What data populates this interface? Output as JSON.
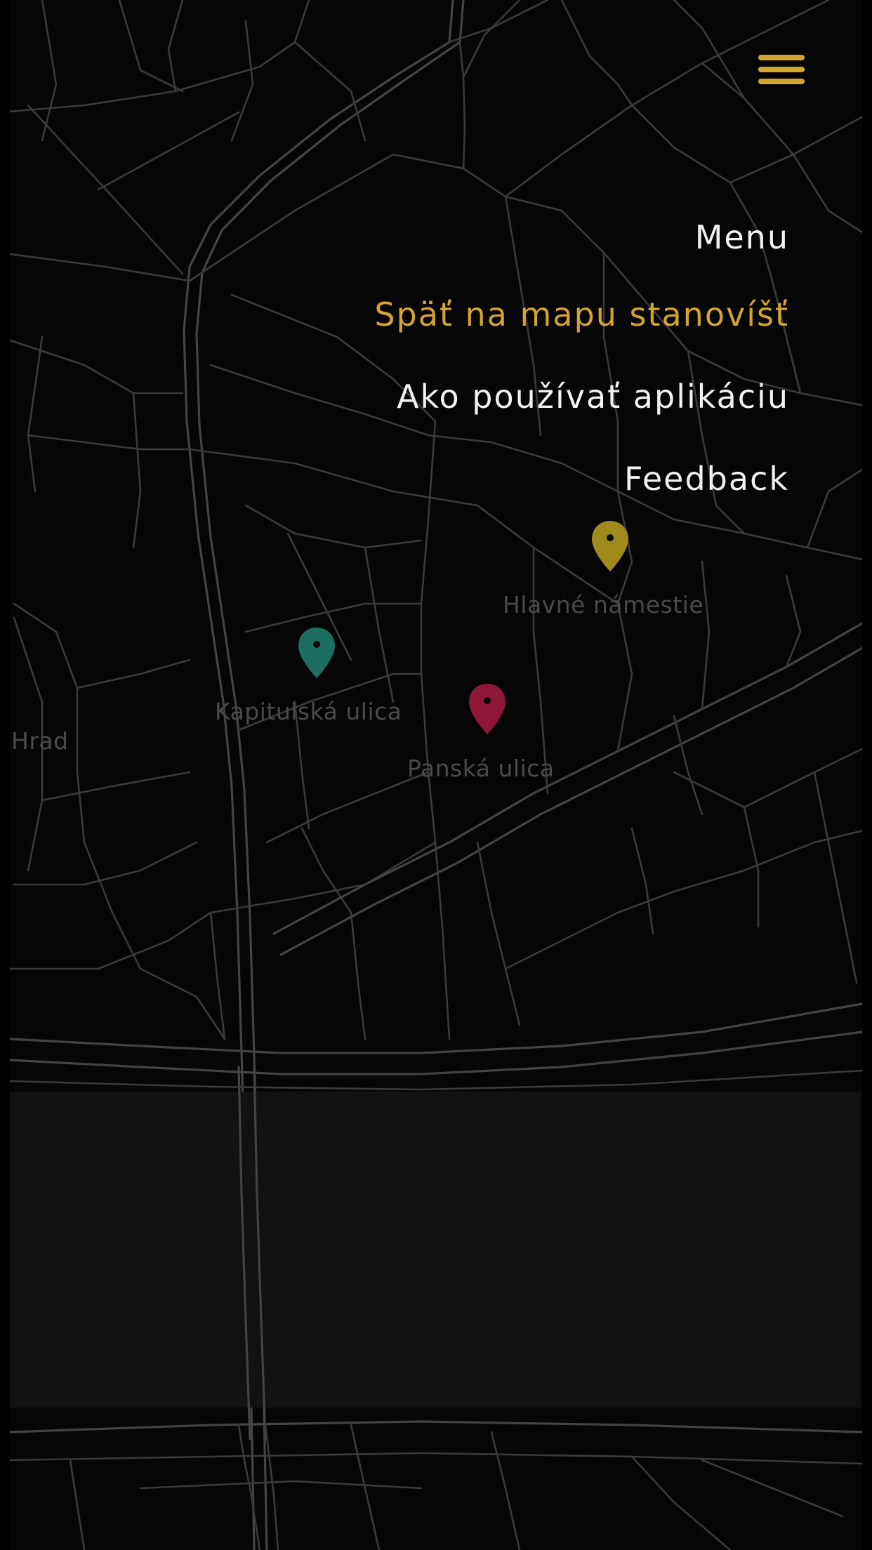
{
  "menu": {
    "title": "Menu",
    "items": [
      {
        "label": "Späť na mapu stanovíšť",
        "active": true
      },
      {
        "label": "Ako používať aplikáciu",
        "active": false
      },
      {
        "label": "Feedback",
        "active": false
      }
    ]
  },
  "map": {
    "places": [
      {
        "label": "Hlavné námestie",
        "color": "#a08a1c"
      },
      {
        "label": "Kapitulská ulica",
        "color": "#1c6e60"
      },
      {
        "label": "Panská ulica",
        "color": "#8e1638"
      },
      {
        "label": "Hrad"
      }
    ]
  },
  "colors": {
    "accent": "#d4a430",
    "menu_text": "#f2f2f2",
    "background": "#060606",
    "road": "#3a3a3a",
    "river": "#121212"
  },
  "icons": {
    "menu_toggle": "hamburger-icon",
    "marker": "map-pin-icon"
  }
}
